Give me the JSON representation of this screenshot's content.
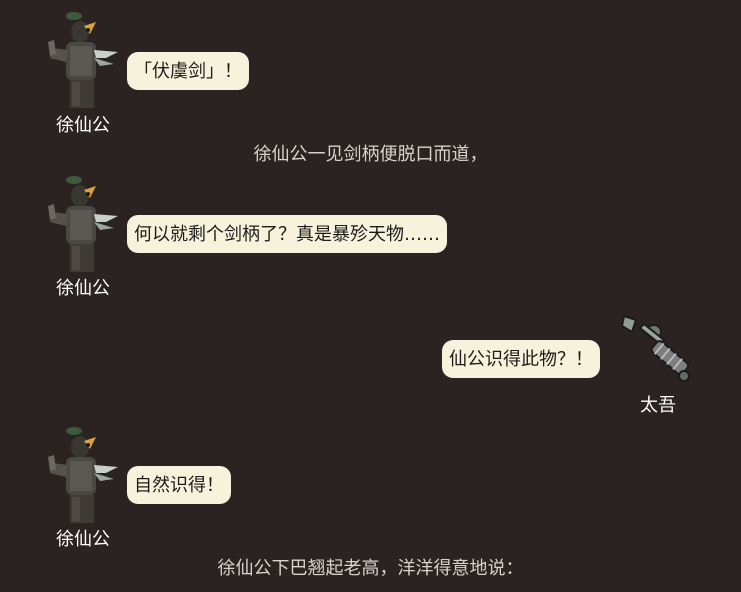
{
  "chat": {
    "messages": [
      {
        "speaker": "徐仙公",
        "text": "「伏虞剑」！"
      },
      {
        "narration": "徐仙公一见剑柄便脱口而道，"
      },
      {
        "speaker": "徐仙公",
        "text": "何以就剩个剑柄了？真是暴殄天物……"
      },
      {
        "speaker": "太吾",
        "text": "仙公识得此物？！"
      },
      {
        "speaker": "徐仙公",
        "text": "自然识得！"
      },
      {
        "narration": "徐仙公下巴翘起老高，洋洋得意地说："
      }
    ]
  },
  "icons": {
    "xu_avatar": "armored-sage-avatar",
    "taiwu_avatar": "sword-hilt-avatar"
  },
  "colors": {
    "background": "#2b2321",
    "bubble": "#f6f2dc",
    "name_text": "#ffffff",
    "narration_text": "#d8d2cf"
  }
}
